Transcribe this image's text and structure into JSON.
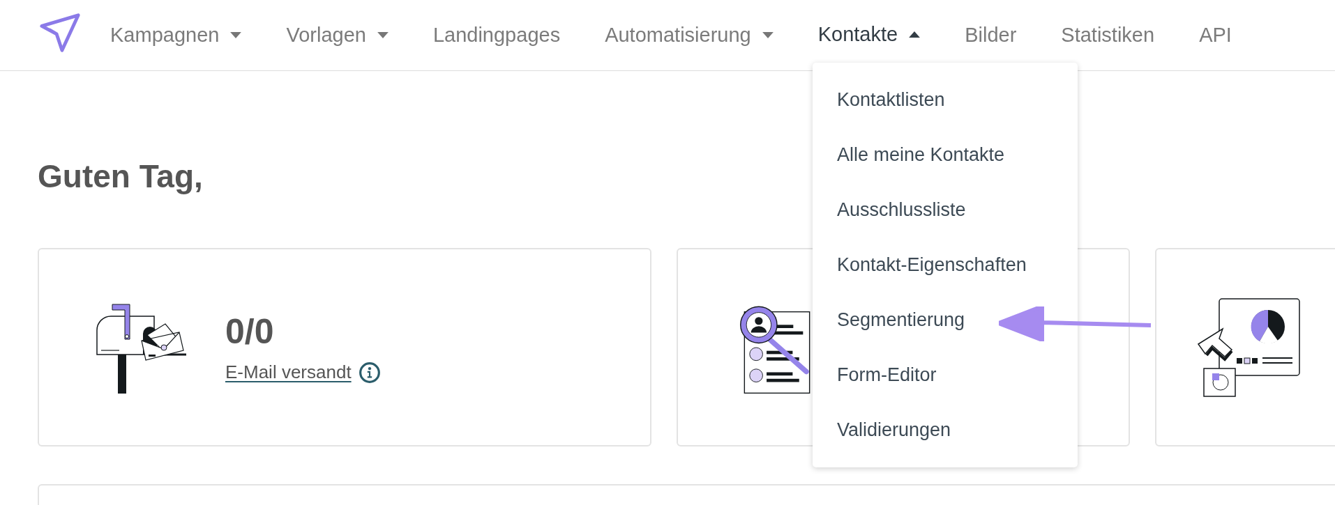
{
  "nav": {
    "items": [
      {
        "label": "Kampagnen",
        "has_menu": true,
        "expanded": false,
        "selected": false
      },
      {
        "label": "Vorlagen",
        "has_menu": true,
        "expanded": false,
        "selected": false
      },
      {
        "label": "Landingpages",
        "has_menu": false,
        "selected": false
      },
      {
        "label": "Automatisierung",
        "has_menu": true,
        "expanded": false,
        "selected": false
      },
      {
        "label": "Kontakte",
        "has_menu": true,
        "expanded": true,
        "selected": true
      },
      {
        "label": "Bilder",
        "has_menu": false,
        "selected": false
      },
      {
        "label": "Statistiken",
        "has_menu": false,
        "selected": false
      },
      {
        "label": "API",
        "has_menu": false,
        "selected": false
      }
    ]
  },
  "dropdown": {
    "items": [
      "Kontaktlisten",
      "Alle meine Kontakte",
      "Ausschlussliste",
      "Kontakt-Eigenschaften",
      "Segmentierung",
      "Form-Editor",
      "Validierungen"
    ]
  },
  "greeting": "Guten Tag,",
  "cards": [
    {
      "kind": "mailbox",
      "value": "0/0",
      "label": "E-Mail versandt"
    },
    {
      "kind": "contacts"
    },
    {
      "kind": "report"
    }
  ]
}
